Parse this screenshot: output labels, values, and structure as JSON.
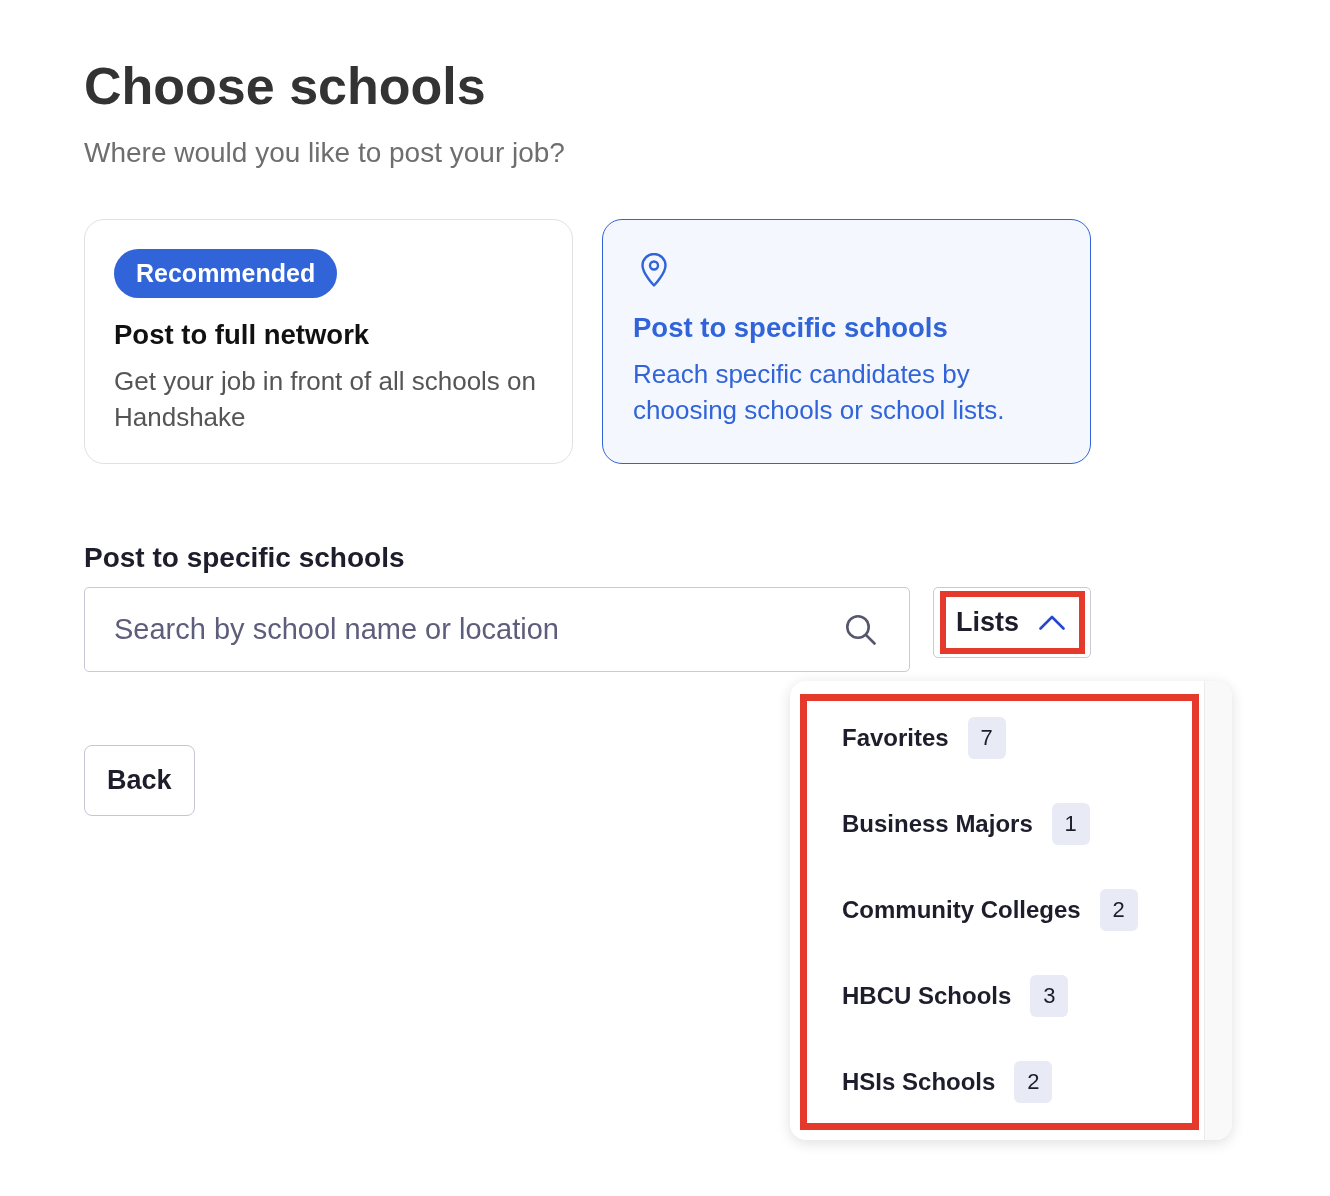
{
  "header": {
    "title": "Choose schools",
    "subtitle": "Where would you like to post your job?"
  },
  "options": [
    {
      "kind": "network",
      "badge": "Recommended",
      "title": "Post to full network",
      "description": "Get your job in front of all schools on Handshake",
      "selected": false
    },
    {
      "kind": "specific",
      "title": "Post to specific schools",
      "description": "Reach specific candidates by choosing schools or school lists.",
      "selected": true
    }
  ],
  "school_search": {
    "label": "Post to specific schools",
    "placeholder": "Search by school name or location"
  },
  "lists_button": {
    "label": "Lists",
    "expanded": true,
    "highlighted": true
  },
  "lists_menu": {
    "highlighted": true,
    "items": [
      {
        "name": "Favorites",
        "count": "7"
      },
      {
        "name": "Business Majors",
        "count": "1"
      },
      {
        "name": "Community Colleges",
        "count": "2"
      },
      {
        "name": "HBCU Schools",
        "count": "3"
      },
      {
        "name": "HSIs Schools",
        "count": "2"
      }
    ]
  },
  "back_button": {
    "label": "Back"
  }
}
